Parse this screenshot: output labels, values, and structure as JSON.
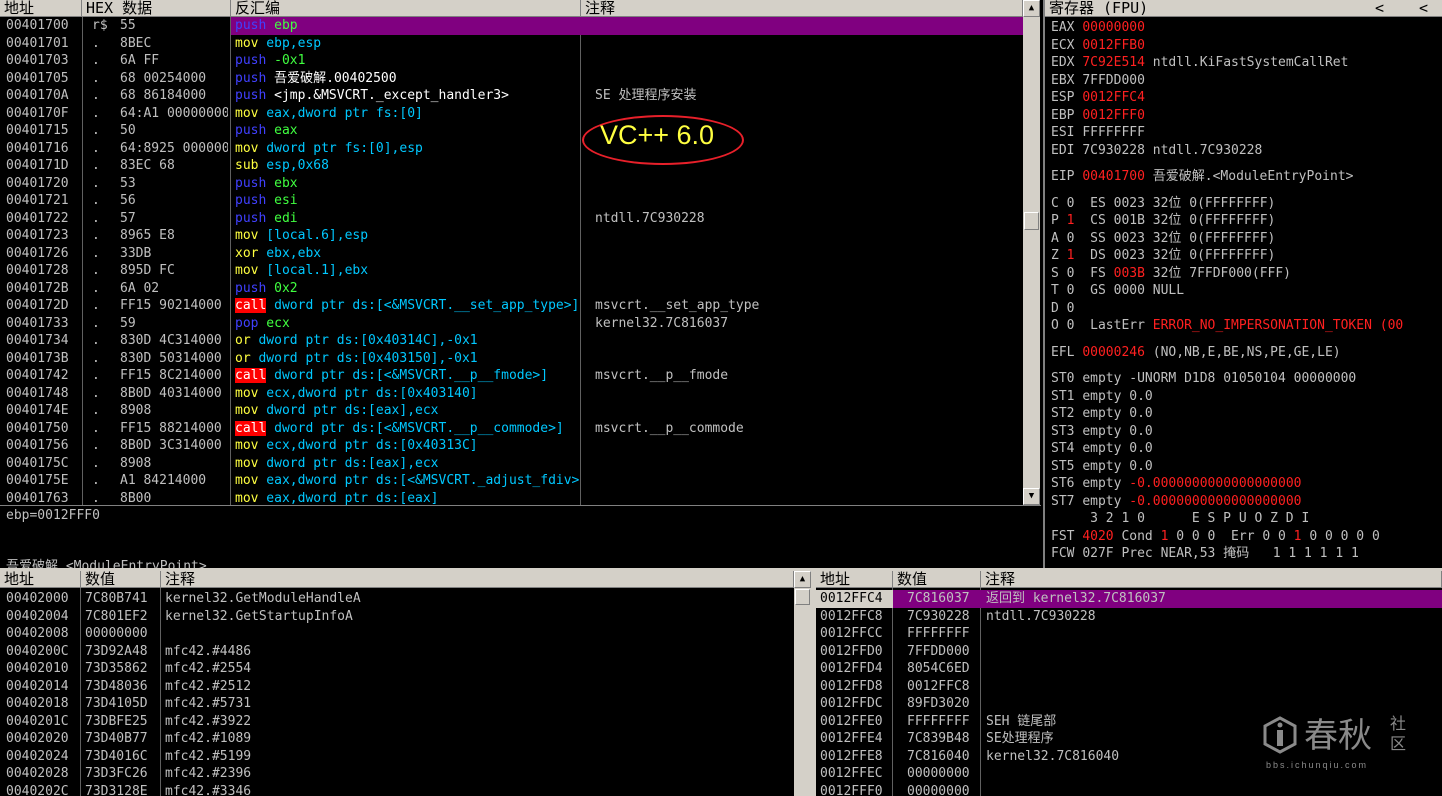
{
  "colors": {
    "purple": "#800080",
    "blue": "#4040ff",
    "cyan": "#00c8ff",
    "yellow": "#ffff40",
    "lime": "#40ff40",
    "call_bg": "#ff0000",
    "red": "#ff2020",
    "panel": "#d4d0c8"
  },
  "disasm": {
    "headers": {
      "address": "地址",
      "hex": "HEX 数据",
      "disasm": "反汇编",
      "comment": "注释"
    },
    "rows": [
      {
        "addr": "00401700",
        "mark": "r$",
        "hex": "55",
        "asm": "push ebp",
        "comment": "",
        "style": "push",
        "selected": true
      },
      {
        "addr": "00401701",
        "mark": ".",
        "hex": "8BEC",
        "asm": "mov ebp,esp",
        "comment": "",
        "style": "mov"
      },
      {
        "addr": "00401703",
        "mark": ".",
        "hex": "6A FF",
        "asm": "push -0x1",
        "comment": "",
        "style": "push"
      },
      {
        "addr": "00401705",
        "mark": ".",
        "hex": "68 00254000",
        "asm": "push 吾爱破解.00402500",
        "comment": "",
        "style": "push"
      },
      {
        "addr": "0040170A",
        "mark": ".",
        "hex": "68 86184000",
        "asm": "push <jmp.&MSVCRT._except_handler3>",
        "comment": "SE 处理程序安装",
        "style": "push"
      },
      {
        "addr": "0040170F",
        "mark": ".",
        "hex": "64:A1 00000000",
        "asm": "mov eax,dword ptr fs:[0]",
        "comment": "",
        "style": "mov"
      },
      {
        "addr": "00401715",
        "mark": ".",
        "hex": "50",
        "asm": "push eax",
        "comment": "",
        "style": "push"
      },
      {
        "addr": "00401716",
        "mark": ".",
        "hex": "64:8925 00000000",
        "asm": "mov dword ptr fs:[0],esp",
        "comment": "",
        "style": "mov"
      },
      {
        "addr": "0040171D",
        "mark": ".",
        "hex": "83EC 68",
        "asm": "sub esp,0x68",
        "comment": "",
        "style": "mov"
      },
      {
        "addr": "00401720",
        "mark": ".",
        "hex": "53",
        "asm": "push ebx",
        "comment": "",
        "style": "push"
      },
      {
        "addr": "00401721",
        "mark": ".",
        "hex": "56",
        "asm": "push esi",
        "comment": "",
        "style": "push"
      },
      {
        "addr": "00401722",
        "mark": ".",
        "hex": "57",
        "asm": "push edi",
        "comment": "ntdll.7C930228",
        "style": "push"
      },
      {
        "addr": "00401723",
        "mark": ".",
        "hex": "8965 E8",
        "asm": "mov [local.6],esp",
        "comment": "",
        "style": "mov"
      },
      {
        "addr": "00401726",
        "mark": ".",
        "hex": "33DB",
        "asm": "xor ebx,ebx",
        "comment": "",
        "style": "mov"
      },
      {
        "addr": "00401728",
        "mark": ".",
        "hex": "895D FC",
        "asm": "mov [local.1],ebx",
        "comment": "",
        "style": "mov"
      },
      {
        "addr": "0040172B",
        "mark": ".",
        "hex": "6A 02",
        "asm": "push 0x2",
        "comment": "",
        "style": "push"
      },
      {
        "addr": "0040172D",
        "mark": ".",
        "hex": "FF15 90214000",
        "asm": "call dword ptr ds:[<&MSVCRT.__set_app_type>]",
        "comment": "msvcrt.__set_app_type",
        "style": "call"
      },
      {
        "addr": "00401733",
        "mark": ".",
        "hex": "59",
        "asm": "pop ecx",
        "comment": "kernel32.7C816037",
        "style": "push"
      },
      {
        "addr": "00401734",
        "mark": ".",
        "hex": "830D 4C314000 FF",
        "asm": "or dword ptr ds:[0x40314C],-0x1",
        "comment": "",
        "style": "mov"
      },
      {
        "addr": "0040173B",
        "mark": ".",
        "hex": "830D 50314000 FF",
        "asm": "or dword ptr ds:[0x403150],-0x1",
        "comment": "",
        "style": "mov"
      },
      {
        "addr": "00401742",
        "mark": ".",
        "hex": "FF15 8C214000",
        "asm": "call dword ptr ds:[<&MSVCRT.__p__fmode>]",
        "comment": "msvcrt.__p__fmode",
        "style": "call"
      },
      {
        "addr": "00401748",
        "mark": ".",
        "hex": "8B0D 40314000",
        "asm": "mov ecx,dword ptr ds:[0x403140]",
        "comment": "",
        "style": "mov"
      },
      {
        "addr": "0040174E",
        "mark": ".",
        "hex": "8908",
        "asm": "mov dword ptr ds:[eax],ecx",
        "comment": "",
        "style": "mov"
      },
      {
        "addr": "00401750",
        "mark": ".",
        "hex": "FF15 88214000",
        "asm": "call dword ptr ds:[<&MSVCRT.__p__commode>]",
        "comment": "msvcrt.__p__commode",
        "style": "call"
      },
      {
        "addr": "00401756",
        "mark": ".",
        "hex": "8B0D 3C314000",
        "asm": "mov ecx,dword ptr ds:[0x40313C]",
        "comment": "",
        "style": "mov"
      },
      {
        "addr": "0040175C",
        "mark": ".",
        "hex": "8908",
        "asm": "mov dword ptr ds:[eax],ecx",
        "comment": "",
        "style": "mov"
      },
      {
        "addr": "0040175E",
        "mark": ".",
        "hex": "A1 84214000",
        "asm": "mov eax,dword ptr ds:[<&MSVCRT._adjust_fdiv>]",
        "comment": "",
        "style": "mov"
      },
      {
        "addr": "00401763",
        "mark": ".",
        "hex": "8B00",
        "asm": "mov eax,dword ptr ds:[eax]",
        "comment": "",
        "style": "mov"
      }
    ],
    "annotation": "VC++ 6.0"
  },
  "info": {
    "line1": "ebp=0012FFF0",
    "line2": "吾爱破解.<ModuleEntryPoint>"
  },
  "registers": {
    "title": "寄存器 (FPU)",
    "nav_prev": "<",
    "nav_next": "<",
    "gp": [
      {
        "name": "EAX",
        "value": "00000000",
        "changed": true,
        "note": ""
      },
      {
        "name": "ECX",
        "value": "0012FFB0",
        "changed": true,
        "note": ""
      },
      {
        "name": "EDX",
        "value": "7C92E514",
        "changed": true,
        "note": "ntdll.KiFastSystemCallRet"
      },
      {
        "name": "EBX",
        "value": "7FFDD000",
        "changed": false,
        "note": ""
      },
      {
        "name": "ESP",
        "value": "0012FFC4",
        "changed": true,
        "note": ""
      },
      {
        "name": "EBP",
        "value": "0012FFF0",
        "changed": true,
        "note": ""
      },
      {
        "name": "ESI",
        "value": "FFFFFFFF",
        "changed": false,
        "note": ""
      },
      {
        "name": "EDI",
        "value": "7C930228",
        "changed": false,
        "note": "ntdll.7C930228"
      }
    ],
    "eip": {
      "name": "EIP",
      "value": "00401700",
      "note": "吾爱破解.<ModuleEntryPoint>"
    },
    "flags": [
      {
        "f": "C",
        "v": "0",
        "red": false,
        "seg": "ES",
        "sv": "0023",
        "sred": false,
        "bits": "32位",
        "base": "0(FFFFFFFF)"
      },
      {
        "f": "P",
        "v": "1",
        "red": true,
        "seg": "CS",
        "sv": "001B",
        "sred": false,
        "bits": "32位",
        "base": "0(FFFFFFFF)"
      },
      {
        "f": "A",
        "v": "0",
        "red": false,
        "seg": "SS",
        "sv": "0023",
        "sred": false,
        "bits": "32位",
        "base": "0(FFFFFFFF)"
      },
      {
        "f": "Z",
        "v": "1",
        "red": true,
        "seg": "DS",
        "sv": "0023",
        "sred": false,
        "bits": "32位",
        "base": "0(FFFFFFFF)"
      },
      {
        "f": "S",
        "v": "0",
        "red": false,
        "seg": "FS",
        "sv": "003B",
        "sred": true,
        "bits": "32位",
        "base": "7FFDF000(FFF)"
      },
      {
        "f": "T",
        "v": "0",
        "red": false,
        "seg": "GS",
        "sv": "0000",
        "sred": false,
        "bits": "NULL",
        "base": ""
      },
      {
        "f": "D",
        "v": "0",
        "red": false,
        "seg": "",
        "sv": "",
        "sred": false,
        "bits": "",
        "base": ""
      }
    ],
    "lasterr": {
      "f": "O",
      "v": "0",
      "label": "LastErr",
      "value": "ERROR_NO_IMPERSONATION_TOKEN (00"
    },
    "efl": {
      "name": "EFL",
      "value": "00000246",
      "text": "(NO,NB,E,BE,NS,PE,GE,LE)"
    },
    "fpu": [
      {
        "name": "ST0",
        "tag": "empty",
        "value": "-UNORM D1D8 01050104 00000000",
        "red": false
      },
      {
        "name": "ST1",
        "tag": "empty",
        "value": "0.0",
        "red": false
      },
      {
        "name": "ST2",
        "tag": "empty",
        "value": "0.0",
        "red": false
      },
      {
        "name": "ST3",
        "tag": "empty",
        "value": "0.0",
        "red": false
      },
      {
        "name": "ST4",
        "tag": "empty",
        "value": "0.0",
        "red": false
      },
      {
        "name": "ST5",
        "tag": "empty",
        "value": "0.0",
        "red": false
      },
      {
        "name": "ST6",
        "tag": "empty",
        "value": "-0.0000000000000000000",
        "red": true
      },
      {
        "name": "ST7",
        "tag": "empty",
        "value": "-0.0000000000000000000",
        "red": true
      }
    ],
    "bits_header": "     3 2 1 0      E S P U O Z D I",
    "fst": {
      "name": "FST",
      "value": "4020",
      "label": "Cond",
      "b1": "1",
      "rest": "0 0 0",
      "err": "Err 0 0",
      "e1": "1",
      "erest": "0 0 0 0 0"
    },
    "fcw": {
      "name": "FCW",
      "value": "027F",
      "label": "Prec NEAR,53",
      "mask": "掩码",
      "mbits": "1 1 1 1 1 1"
    }
  },
  "dump": {
    "headers": {
      "address": "地址",
      "value": "数值",
      "comment": "注释"
    },
    "rows": [
      {
        "addr": "00402000",
        "val": "7C80B741",
        "comment": "kernel32.GetModuleHandleA"
      },
      {
        "addr": "00402004",
        "val": "7C801EF2",
        "comment": "kernel32.GetStartupInfoA"
      },
      {
        "addr": "00402008",
        "val": "00000000",
        "comment": ""
      },
      {
        "addr": "0040200C",
        "val": "73D92A48",
        "comment": "mfc42.#4486"
      },
      {
        "addr": "00402010",
        "val": "73D35862",
        "comment": "mfc42.#2554"
      },
      {
        "addr": "00402014",
        "val": "73D48036",
        "comment": "mfc42.#2512"
      },
      {
        "addr": "00402018",
        "val": "73D4105D",
        "comment": "mfc42.#5731"
      },
      {
        "addr": "0040201C",
        "val": "73DBFE25",
        "comment": "mfc42.#3922"
      },
      {
        "addr": "00402020",
        "val": "73D40B77",
        "comment": "mfc42.#1089"
      },
      {
        "addr": "00402024",
        "val": "73D4016C",
        "comment": "mfc42.#5199"
      },
      {
        "addr": "00402028",
        "val": "73D3FC26",
        "comment": "mfc42.#2396"
      },
      {
        "addr": "0040202C",
        "val": "73D3128E",
        "comment": "mfc42.#3346"
      }
    ]
  },
  "stack": {
    "headers": {
      "address": "地址",
      "value": "数值",
      "comment": "注释"
    },
    "rows": [
      {
        "addr": "0012FFC4",
        "val": "7C816037",
        "comment": "返回到 kernel32.7C816037",
        "selected": true
      },
      {
        "addr": "0012FFC8",
        "val": "7C930228",
        "comment": "ntdll.7C930228"
      },
      {
        "addr": "0012FFCC",
        "val": "FFFFFFFF",
        "comment": ""
      },
      {
        "addr": "0012FFD0",
        "val": "7FFDD000",
        "comment": ""
      },
      {
        "addr": "0012FFD4",
        "val": "8054C6ED",
        "comment": ""
      },
      {
        "addr": "0012FFD8",
        "val": "0012FFC8",
        "comment": ""
      },
      {
        "addr": "0012FFDC",
        "val": "89FD3020",
        "comment": ""
      },
      {
        "addr": "0012FFE0",
        "val": "FFFFFFFF",
        "comment": "SEH 链尾部"
      },
      {
        "addr": "0012FFE4",
        "val": "7C839B48",
        "comment": "SE处理程序"
      },
      {
        "addr": "0012FFE8",
        "val": "7C816040",
        "comment": "kernel32.7C816040"
      },
      {
        "addr": "0012FFEC",
        "val": "00000000",
        "comment": ""
      },
      {
        "addr": "0012FFF0",
        "val": "00000000",
        "comment": ""
      }
    ]
  },
  "watermark": {
    "brand": "春秋",
    "side1": "社",
    "side2": "区",
    "url": "bbs.ichunqiu.com"
  }
}
